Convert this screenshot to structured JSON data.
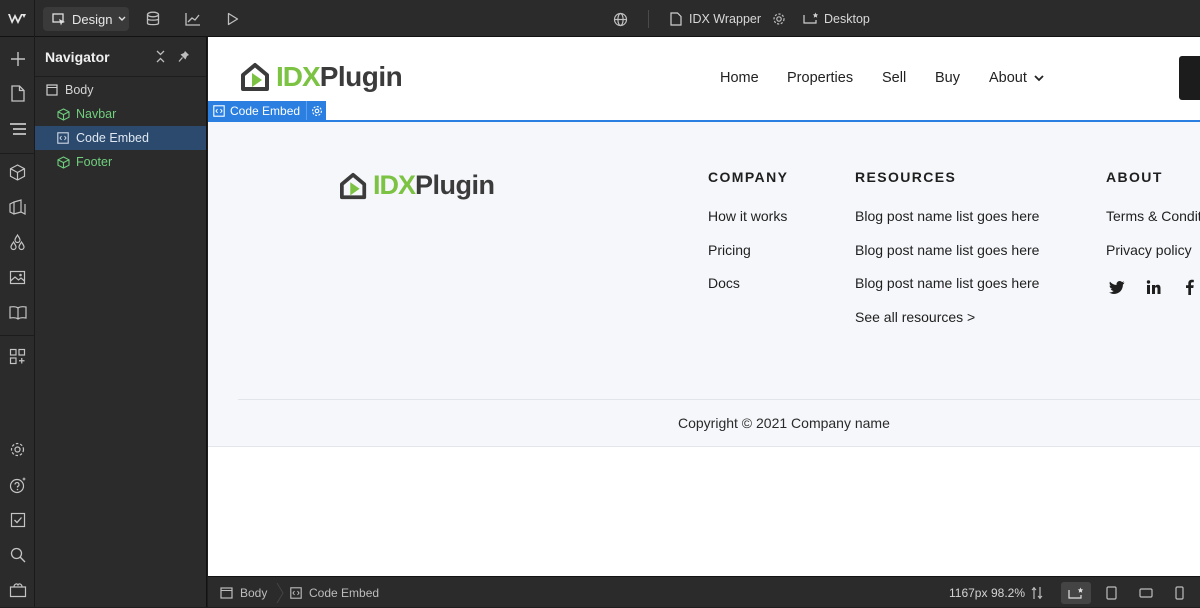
{
  "topbar": {
    "mode_label": "Design",
    "page_name": "IDX Wrapper",
    "breakpoint_label": "Desktop"
  },
  "navigator": {
    "title": "Navigator",
    "items": [
      {
        "label": "Body",
        "icon": "box-outline-icon"
      },
      {
        "label": "Navbar",
        "icon": "component-icon"
      },
      {
        "label": "Code Embed",
        "icon": "code-embed-icon"
      },
      {
        "label": "Footer",
        "icon": "component-icon"
      }
    ]
  },
  "site": {
    "logo_idx": "IDX",
    "logo_plugin": "Plugin",
    "menu": [
      "Home",
      "Properties",
      "Sell",
      "Buy",
      "About"
    ],
    "selection_label": "Code Embed",
    "footer": {
      "columns": [
        {
          "title": "COMPANY",
          "links": [
            "How it works",
            "Pricing",
            "Docs"
          ]
        },
        {
          "title": "RESOURCES",
          "links": [
            "Blog post name list goes here",
            "Blog post name list goes here",
            "Blog post name list goes here",
            "See all resources >"
          ]
        },
        {
          "title": "ABOUT",
          "links": [
            "Terms & Conditions",
            "Privacy policy"
          ]
        }
      ],
      "social": [
        "twitter-icon",
        "linkedin-icon",
        "facebook-icon"
      ],
      "copyright": "Copyright © 2021 Company name"
    }
  },
  "statusbar": {
    "crumbs": [
      "Body",
      "Code Embed"
    ],
    "width_readout": "1167px",
    "zoom_readout": "98.2%"
  },
  "colors": {
    "accent": "#2a7fe0",
    "logo_green": "#7cc243",
    "logo_dark": "#3b3b3b",
    "nav_green": "#6fcf7d"
  }
}
